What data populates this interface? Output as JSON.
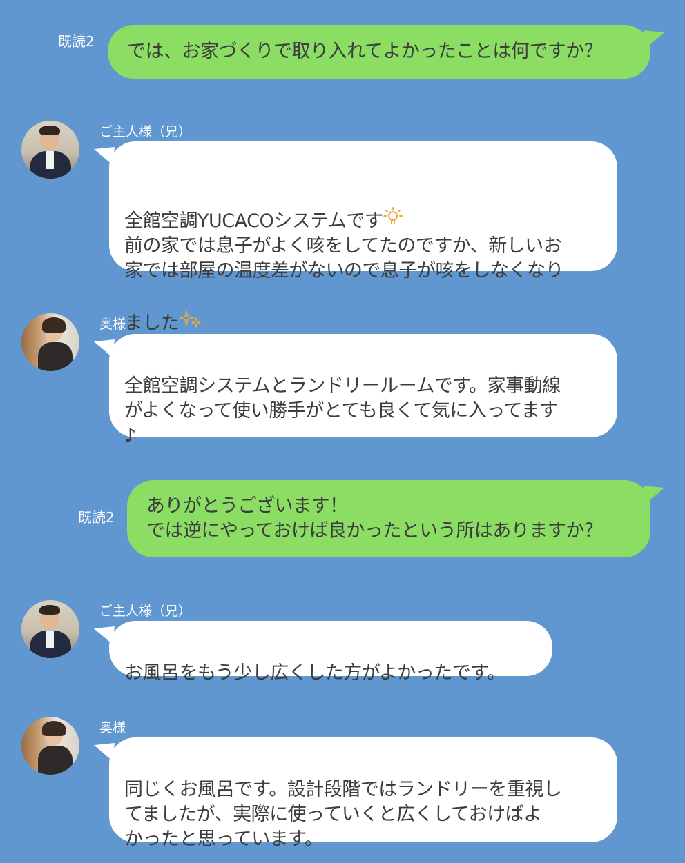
{
  "colors": {
    "background": "#6197d0",
    "outgoing_bubble": "#8bde63",
    "incoming_bubble": "#ffffff",
    "text": "#3d3d3d"
  },
  "messages": [
    {
      "direction": "outgoing",
      "read_label": "既読2",
      "text": "では、お家づくりで取り入れてよかったことは何ですか？"
    },
    {
      "direction": "incoming",
      "sender": "ご主人様（兄）",
      "avatar": "husband-avatar",
      "text_line1": "全館空調YUCACOシステムです",
      "emoji1": "lightbulb-icon",
      "text_body": "前の家では息子がよく咳をしてたのですか、新しいお\n家では部屋の温度差がないので息子が咳をしなくなり\nました",
      "emoji2": "sparkles-icon"
    },
    {
      "direction": "incoming",
      "sender": "奥様",
      "avatar": "wife-avatar",
      "text": "全館空調システムとランドリールームです。家事動線\nがよくなって使い勝手がとても良くて気に入ってます\n♪"
    },
    {
      "direction": "outgoing",
      "read_label": "既読2",
      "text": "ありがとうございます！\nでは逆にやっておけば良かったという所はありますか？"
    },
    {
      "direction": "incoming",
      "sender": "ご主人様（兄）",
      "avatar": "husband-avatar",
      "text": "お風呂をもう少し広くした方がよかったです。"
    },
    {
      "direction": "incoming",
      "sender": "奥様",
      "avatar": "wife-avatar",
      "text": "同じくお風呂です。設計段階ではランドリーを重視し\nてましたが、実際に使っていくと広くしておけばよ\nかったと思っています。"
    }
  ]
}
